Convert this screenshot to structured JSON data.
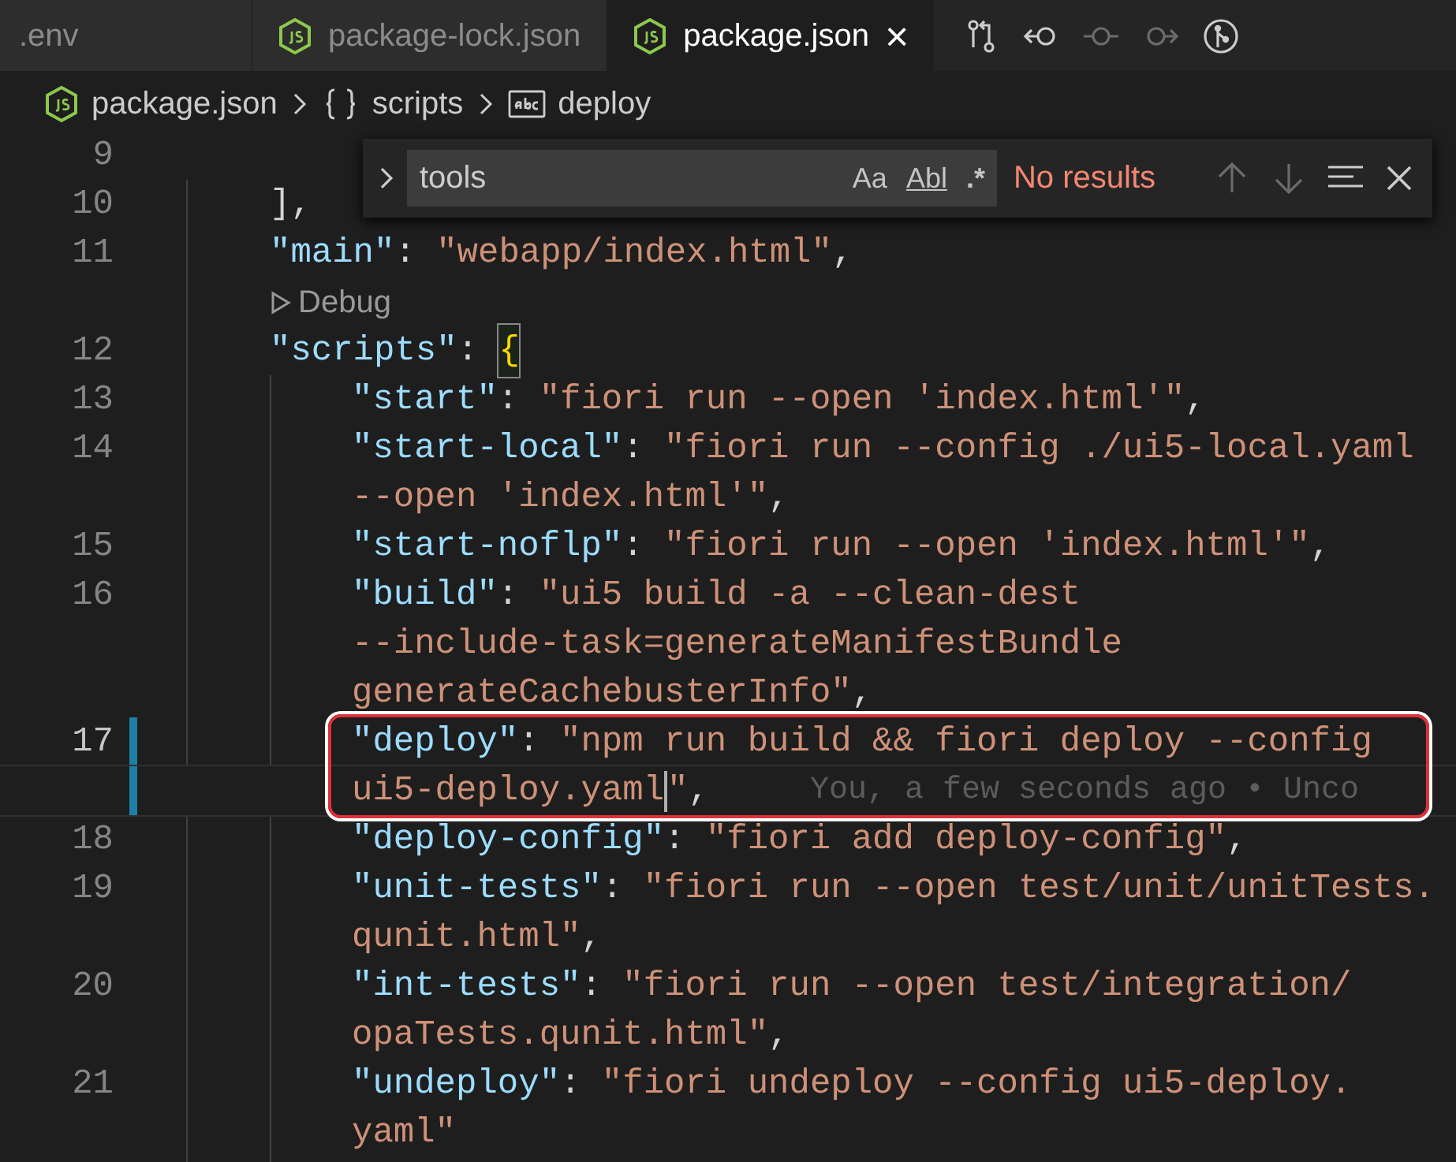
{
  "tabs": [
    {
      "label": ".env",
      "selected": false,
      "kind": "plain"
    },
    {
      "label": "package-lock.json",
      "selected": false,
      "kind": "node"
    },
    {
      "label": "package.json",
      "selected": true,
      "kind": "node",
      "close": "×"
    }
  ],
  "editor_actions": [
    {
      "kind": "compare",
      "disabled": false
    },
    {
      "kind": "previous",
      "disabled": false
    },
    {
      "kind": "dot",
      "disabled": true
    },
    {
      "kind": "next",
      "disabled": true
    },
    {
      "kind": "graph",
      "disabled": false
    }
  ],
  "breadcrumb": [
    {
      "kind": "js",
      "label": "package.json"
    },
    {
      "kind": "object",
      "label": "scripts"
    },
    {
      "kind": "string",
      "label": "deploy"
    }
  ],
  "find_widget": {
    "value": "tools",
    "options": [
      "Aa",
      "Abl",
      ".*"
    ],
    "status": "No results"
  },
  "lines": [
    {
      "kind": "blank",
      "number": "9"
    },
    {
      "kind": "outer",
      "number": "10",
      "tokens": [
        {
          "kind": "punct",
          "text": "],"
        }
      ]
    },
    {
      "kind": "outer",
      "number": "11",
      "tokens": [
        {
          "kind": "key",
          "text": "\"main\""
        },
        {
          "kind": "punct",
          "text": ":"
        },
        {
          "kind": "string",
          "text": "\"webapp/index.html\""
        },
        {
          "kind": "punct",
          "text": ","
        }
      ]
    },
    {
      "kind": "lens",
      "text": "Debug"
    },
    {
      "kind": "outer",
      "number": "12",
      "tokens": [
        {
          "kind": "key",
          "text": "\"scripts\""
        },
        {
          "kind": "punct",
          "text": ":"
        },
        {
          "kind": "bracket",
          "text": "{"
        }
      ]
    },
    {
      "kind": "inner",
      "number": "13",
      "tokens": [
        {
          "kind": "key",
          "text": "\"start\""
        },
        {
          "kind": "punct",
          "text": ":"
        },
        {
          "kind": "string",
          "text": "\"fiori run --open 'index.html'\""
        },
        {
          "kind": "punct",
          "text": ","
        }
      ]
    },
    {
      "kind": "inner",
      "number": "14",
      "tokens": [
        {
          "kind": "key",
          "text": "\"start-local\""
        },
        {
          "kind": "punct",
          "text": ":"
        },
        {
          "kind": "string",
          "text": "\"fiori run --config ./ui5-local.yaml"
        }
      ]
    },
    {
      "kind": "inner",
      "tokens": [
        {
          "kind": "string",
          "text": "--open 'index.html'\""
        },
        {
          "kind": "punct",
          "text": ","
        }
      ]
    },
    {
      "kind": "inner",
      "number": "15",
      "tokens": [
        {
          "kind": "key",
          "text": "\"start-noflp\""
        },
        {
          "kind": "punct",
          "text": ":"
        },
        {
          "kind": "string",
          "text": "\"fiori run --open 'index.html'\""
        },
        {
          "kind": "punct",
          "text": ","
        }
      ]
    },
    {
      "kind": "inner",
      "number": "16",
      "tokens": [
        {
          "kind": "key",
          "text": "\"build\""
        },
        {
          "kind": "punct",
          "text": ":"
        },
        {
          "kind": "string",
          "text": "\"ui5 build -a --clean-dest"
        }
      ]
    },
    {
      "kind": "inner",
      "tokens": [
        {
          "kind": "string",
          "text": "--include-task=generateManifestBundle"
        }
      ]
    },
    {
      "kind": "inner",
      "tokens": [
        {
          "kind": "string",
          "text": "generateCachebusterInfo\""
        },
        {
          "kind": "punct",
          "text": ","
        }
      ]
    },
    {
      "kind": "inner",
      "number": "17",
      "active": true,
      "modified": true,
      "boxed": true,
      "tokens": [
        {
          "kind": "key",
          "text": "\"deploy\""
        },
        {
          "kind": "punct",
          "text": ":"
        },
        {
          "kind": "string",
          "text": "\"npm run build && fiori deploy --config"
        }
      ]
    },
    {
      "kind": "inner",
      "current": true,
      "modified": true,
      "boxed": true,
      "tokens": [
        {
          "kind": "string",
          "text": "ui5-deploy.yaml"
        },
        {
          "kind": "cursor"
        },
        {
          "kind": "string",
          "text": "\""
        },
        {
          "kind": "punct",
          "text": ","
        },
        {
          "kind": "blame",
          "text": "You, a few seconds ago • Unco"
        }
      ]
    },
    {
      "kind": "inner",
      "number": "18",
      "tokens": [
        {
          "kind": "key",
          "text": "\"deploy-config\""
        },
        {
          "kind": "punct",
          "text": ":"
        },
        {
          "kind": "string",
          "text": "\"fiori add deploy-config\""
        },
        {
          "kind": "punct",
          "text": ","
        }
      ]
    },
    {
      "kind": "inner",
      "number": "19",
      "tokens": [
        {
          "kind": "key",
          "text": "\"unit-tests\""
        },
        {
          "kind": "punct",
          "text": ":"
        },
        {
          "kind": "string",
          "text": "\"fiori run --open test/unit/unitTests."
        }
      ]
    },
    {
      "kind": "inner",
      "tokens": [
        {
          "kind": "string",
          "text": "qunit.html\""
        },
        {
          "kind": "punct",
          "text": ","
        }
      ]
    },
    {
      "kind": "inner",
      "number": "20",
      "tokens": [
        {
          "kind": "key",
          "text": "\"int-tests\""
        },
        {
          "kind": "punct",
          "text": ":"
        },
        {
          "kind": "string",
          "text": "\"fiori run --open test/integration/"
        }
      ]
    },
    {
      "kind": "inner",
      "tokens": [
        {
          "kind": "string",
          "text": "opaTests.qunit.html\""
        },
        {
          "kind": "punct",
          "text": ","
        }
      ]
    },
    {
      "kind": "inner",
      "number": "21",
      "tokens": [
        {
          "kind": "key",
          "text": "\"undeploy\""
        },
        {
          "kind": "punct",
          "text": ":"
        },
        {
          "kind": "string",
          "text": "\"fiori undeploy --config ui5-deploy."
        }
      ]
    },
    {
      "kind": "inner",
      "tokens": [
        {
          "kind": "string",
          "text": "yaml\""
        }
      ]
    }
  ]
}
